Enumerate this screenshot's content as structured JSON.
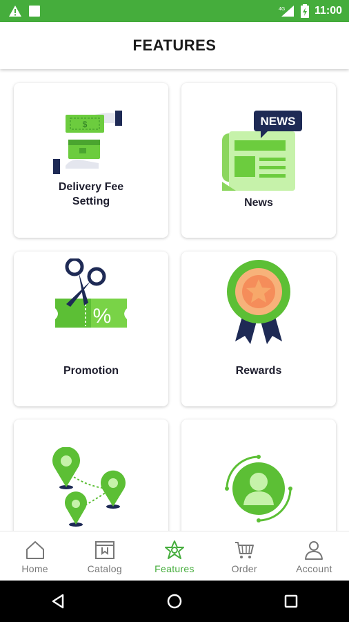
{
  "colors": {
    "primary": "#45ad3c",
    "nav_active": "#45ad3c",
    "nav_inactive": "#777777"
  },
  "status_bar": {
    "signal": "4G",
    "time": "11:00",
    "left_icons": [
      "warning-icon",
      "square-notification-icon"
    ]
  },
  "header": {
    "title": "FEATURES"
  },
  "features": [
    {
      "label": "Delivery Fee\nSetting",
      "icon": "money-handover-icon"
    },
    {
      "label": "News",
      "icon": "newspaper-icon",
      "badge": "NEWS"
    },
    {
      "label": "Promotion",
      "icon": "coupon-scissors-icon"
    },
    {
      "label": "Rewards",
      "icon": "award-ribbon-icon"
    },
    {
      "label": "",
      "icon": "location-pins-icon"
    },
    {
      "label": "",
      "icon": "user-profile-icon"
    }
  ],
  "bottom_nav": [
    {
      "label": "Home",
      "icon": "home-icon"
    },
    {
      "label": "Catalog",
      "icon": "catalog-icon"
    },
    {
      "label": "Features",
      "icon": "star-badge-icon",
      "active": true
    },
    {
      "label": "Order",
      "icon": "cart-icon"
    },
    {
      "label": "Account",
      "icon": "person-icon"
    }
  ]
}
